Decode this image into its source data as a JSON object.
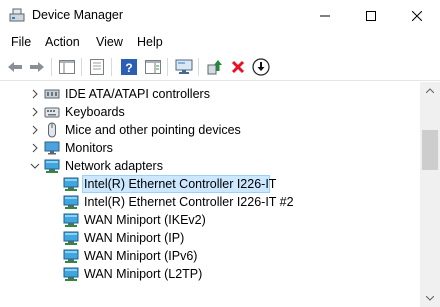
{
  "window": {
    "title": "Device Manager"
  },
  "menu": [
    "File",
    "Action",
    "View",
    "Help"
  ],
  "toolbar": {
    "buttons": [
      "back",
      "forward",
      "show-hide-console-tree",
      "properties",
      "help",
      "action-pane",
      "scan-for-hardware",
      "update-driver",
      "uninstall-device",
      "disable-device"
    ]
  },
  "tree": {
    "items": [
      {
        "label": "IDE ATA/ATAPI controllers",
        "icon": "ide-controller-icon",
        "expanded": false
      },
      {
        "label": "Keyboards",
        "icon": "keyboard-icon",
        "expanded": false
      },
      {
        "label": "Mice and other pointing devices",
        "icon": "mouse-icon",
        "expanded": false
      },
      {
        "label": "Monitors",
        "icon": "monitor-icon",
        "expanded": false
      },
      {
        "label": "Network adapters",
        "icon": "network-adapter-icon",
        "expanded": true
      },
      {
        "label": "Intel(R) Ethernet Controller I226-IT",
        "icon": "network-adapter-icon",
        "selected": true
      },
      {
        "label": "Intel(R) Ethernet Controller I226-IT #2",
        "icon": "network-adapter-icon"
      },
      {
        "label": "WAN Miniport (IKEv2)",
        "icon": "network-adapter-icon"
      },
      {
        "label": "WAN Miniport (IP)",
        "icon": "network-adapter-icon"
      },
      {
        "label": "WAN Miniport (IPv6)",
        "icon": "network-adapter-icon"
      },
      {
        "label": "WAN Miniport (L2TP)",
        "icon": "network-adapter-icon"
      }
    ]
  },
  "colors": {
    "selection_bg": "#cce8ff",
    "selection_border": "#99d1ff",
    "uninstall_red": "#e81123",
    "update_green": "#1e8a3a"
  }
}
